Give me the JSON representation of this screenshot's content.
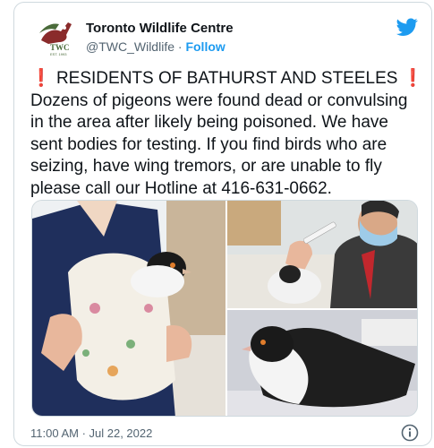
{
  "tweet": {
    "author_name": "Toronto Wildlife Centre",
    "handle": "@TWC_Wildlife",
    "separator": "·",
    "follow_label": "Follow",
    "avatar_text": "TWC",
    "avatar_subtext": "EST. 1993",
    "headline_mark": "❗",
    "headline": "RESIDENTS OF BATHURST AND STEELES",
    "body": "Dozens of pigeons were found dead or convulsing in the area after likely being poisoned. We have sent bodies for testing. If you find birds who are seizing, have wing tremors, or are unable to fly please call our Hotline at 416-631-0662.",
    "timestamp": "11:00 AM · Jul 22, 2022"
  },
  "media": {
    "photos": [
      {
        "subject": "pigeon wrapped in floral towel held by staff in blue scrubs"
      },
      {
        "subject": "staff in face mask feeding pigeon with syringe"
      },
      {
        "subject": "black and white pigeon resting on towel"
      }
    ]
  },
  "icons": {
    "brand": "twitter-bird-icon",
    "info": "info-icon"
  },
  "colors": {
    "link": "#1d9bf0",
    "alert": "#e0222e",
    "brand_bird": "#1d9bf0",
    "logo_green": "#4a6b3a",
    "logo_red": "#8a2b2b"
  }
}
